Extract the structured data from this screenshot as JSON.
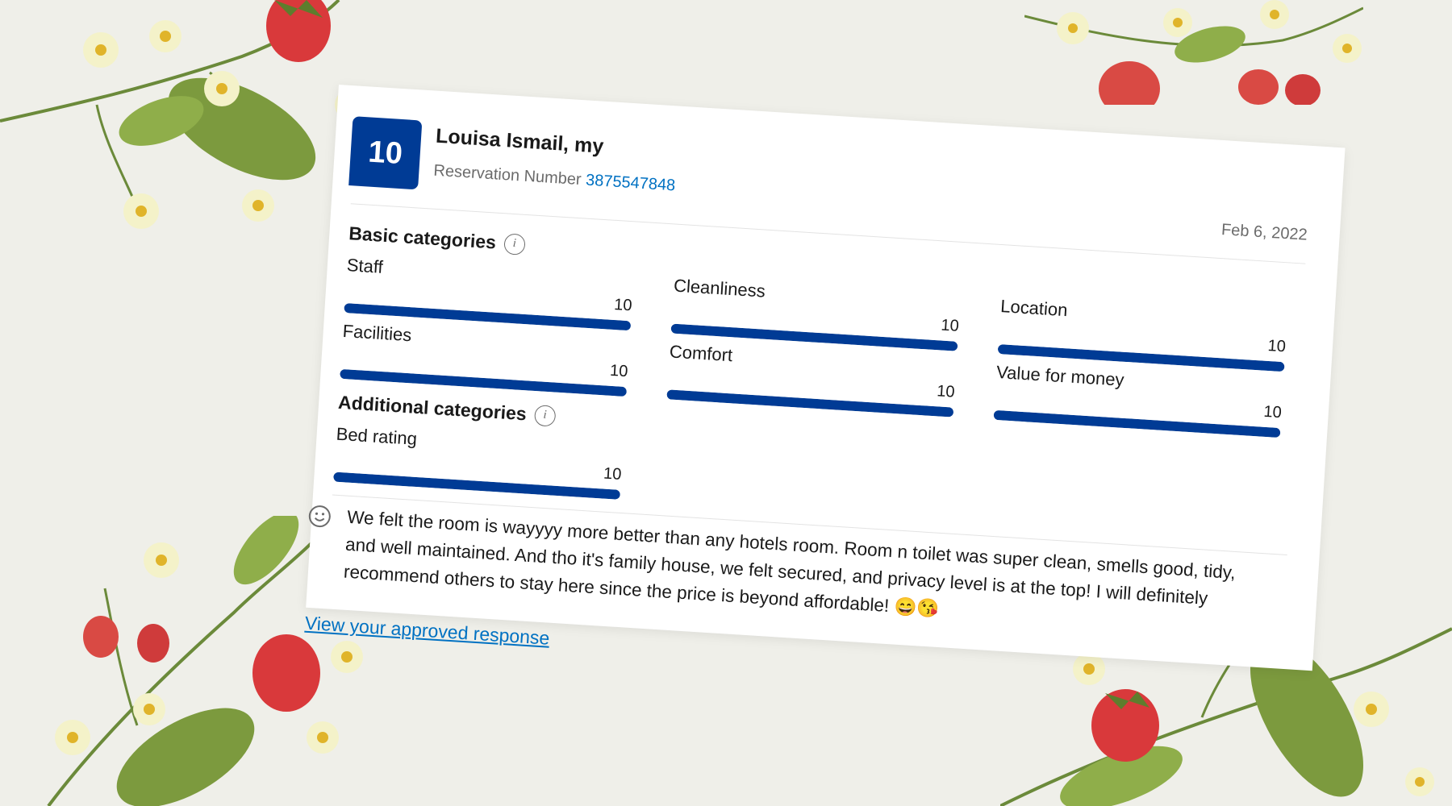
{
  "review": {
    "score": "10",
    "reviewer_name": "Louisa Ismail, my",
    "reservation_label": "Reservation Number",
    "reservation_number": "3875547848",
    "date": "Feb 6, 2022",
    "basic_heading": "Basic categories",
    "additional_heading": "Additional categories",
    "categories": [
      {
        "label": "Staff",
        "score": "10",
        "level": 1.0
      },
      {
        "label": "Cleanliness",
        "score": "10",
        "level": 1.0
      },
      {
        "label": "Location",
        "score": "10",
        "level": 1.0
      },
      {
        "label": "Facilities",
        "score": "10",
        "level": 1.0
      },
      {
        "label": "Comfort",
        "score": "10",
        "level": 1.0
      },
      {
        "label": "Value for money",
        "score": "10",
        "level": 1.0
      }
    ],
    "additional_categories": [
      {
        "label": "Bed rating",
        "score": "10",
        "level": 1.0
      }
    ],
    "text": "We felt the room is wayyyy more better than any hotels room. Room n toilet was super clean, smells good, tidy, and well maintained. And tho it's family house, we felt secured, and privacy level is at the top! I will definitely recommend others to stay here since the price is beyond affordable! 😄😘",
    "response_link": "View your approved response"
  },
  "colors": {
    "brand_blue": "#003b95",
    "link_blue": "#0071c2",
    "background": "#efefe9"
  }
}
